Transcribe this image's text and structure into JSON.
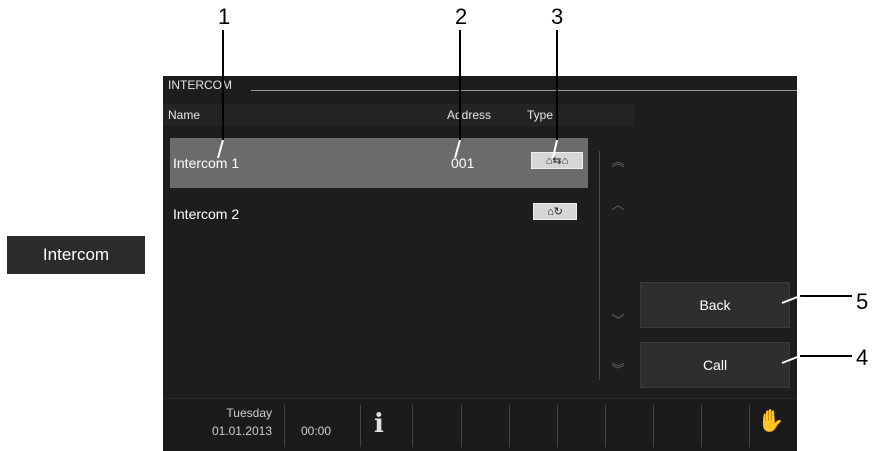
{
  "callouts": [
    "1",
    "2",
    "3",
    "4",
    "5"
  ],
  "side_tab": {
    "label": "Intercom"
  },
  "screen": {
    "title": "INTERCOM",
    "columns": {
      "name": "Name",
      "address": "Address",
      "type": "Type"
    },
    "rows": [
      {
        "name": "Intercom 1",
        "address": "001",
        "type_icon": "house-to-house-icon",
        "selected": true
      },
      {
        "name": "Intercom 2",
        "address": "",
        "type_icon": "house-refresh-icon",
        "selected": false
      }
    ],
    "buttons": {
      "back": "Back",
      "call": "Call"
    },
    "scroll_icons": [
      "double-chevron-up-icon",
      "chevron-up-icon",
      "chevron-down-icon",
      "double-chevron-down-icon"
    ]
  },
  "status_bar": {
    "day": "Tuesday",
    "date": "01.01.2013",
    "time": "00:00",
    "info_icon": "info-icon",
    "hand_icon": "hand-icon"
  }
}
